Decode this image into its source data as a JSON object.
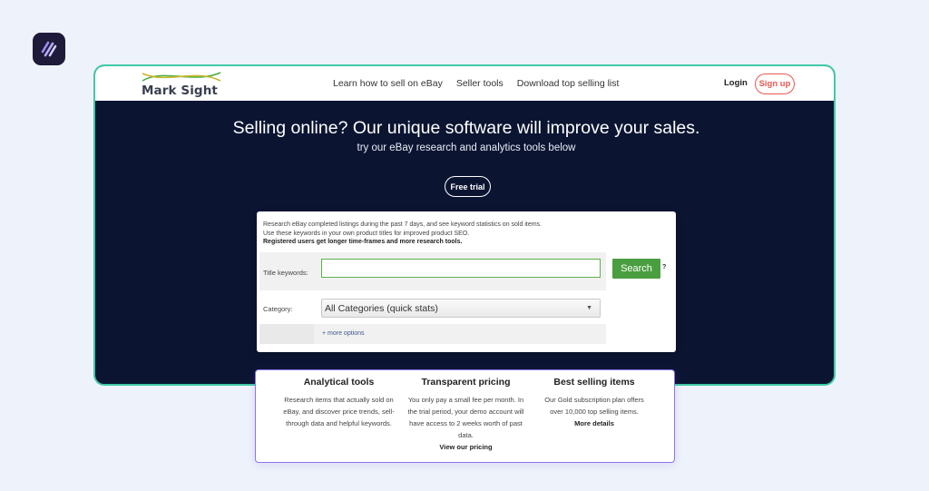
{
  "brand": {
    "name": "Mark Sight"
  },
  "nav": {
    "links": [
      "Learn how to sell on eBay",
      "Seller tools",
      "Download top selling list"
    ],
    "login": "Login",
    "signup": "Sign up"
  },
  "hero": {
    "title": "Selling online? Our unique software will improve your sales.",
    "subtitle": "try our eBay research and analytics tools below",
    "free_trial": "Free trial"
  },
  "search": {
    "intro_line1": "Research eBay completed listings during the past 7 days, and see keyword statistics on sold items.",
    "intro_line2": "Use these keywords in your own product titles for improved product SEO.",
    "intro_line3": "Registered users get longer time-frames and more research tools.",
    "keywords_label": "Title keywords:",
    "keywords_value": "",
    "search_button": "Search",
    "help": "?",
    "category_label": "Category:",
    "category_value": "All Categories (quick stats)",
    "more_options": "+ more options"
  },
  "features": [
    {
      "title": "Analytical tools",
      "text": "Research items that actually sold on eBay, and discover price trends, sell-through data and helpful keywords.",
      "link": ""
    },
    {
      "title": "Transparent pricing",
      "text": "You only pay a small fee per month. In the trial period, your demo account will have access to 2 weeks worth of past data.",
      "link": "View our pricing"
    },
    {
      "title": "Best selling items",
      "text": "Our Gold subscription plan offers over 10,000 top selling items.",
      "link": "More details"
    }
  ],
  "colors": {
    "hero_bg": "#0b1532",
    "frame_border": "#3fc9a8",
    "search_button": "#4a9e3f",
    "signup": "#e8584e",
    "features_border": "#8d74e8"
  }
}
